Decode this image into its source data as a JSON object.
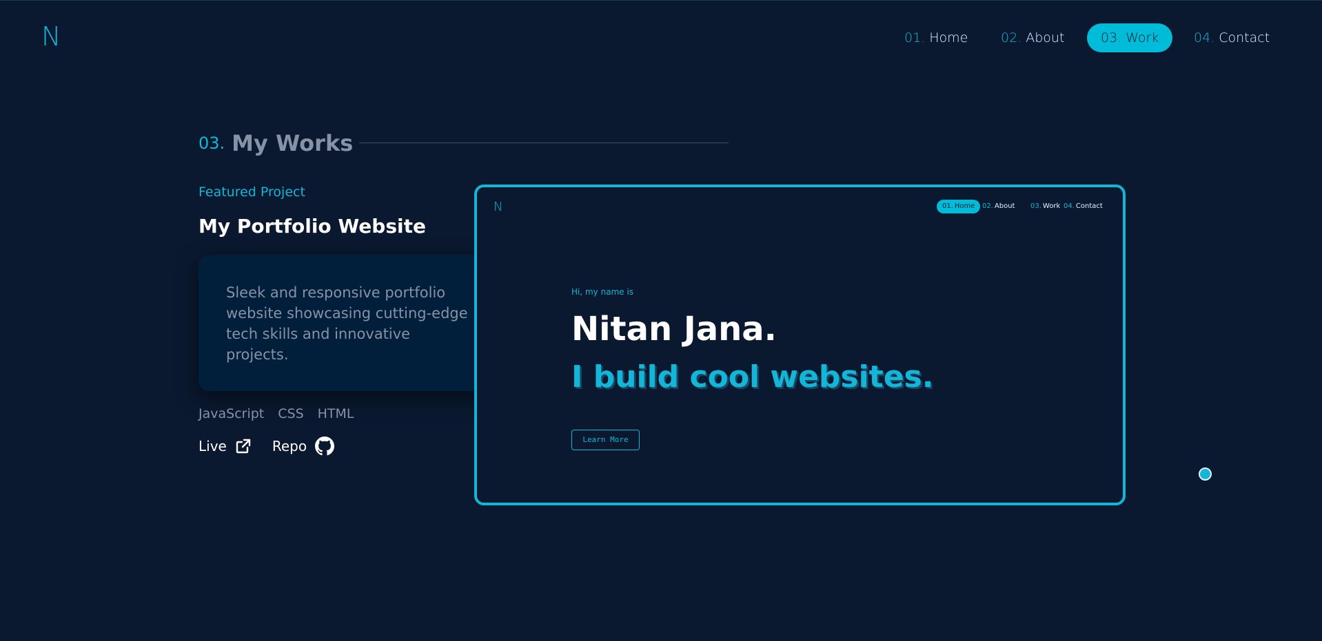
{
  "header": {
    "logo": "N",
    "nav": [
      {
        "num": "01.",
        "label": "Home",
        "active": false
      },
      {
        "num": "02.",
        "label": "About",
        "active": false
      },
      {
        "num": "03.",
        "label": "Work",
        "active": true
      },
      {
        "num": "04.",
        "label": "Contact",
        "active": false
      }
    ]
  },
  "section": {
    "num": "03.",
    "title": "My Works"
  },
  "project": {
    "eyebrow": "Featured Project",
    "title": "My Portfolio Website",
    "description": "Sleek and responsive portfolio website showcasing cutting-edge tech skills and innovative projects.",
    "tech": [
      "JavaScript",
      "CSS",
      "HTML"
    ],
    "links": {
      "live": "Live",
      "repo": "Repo"
    }
  },
  "preview": {
    "logo": "N",
    "nav": [
      {
        "num": "01.",
        "label": "Home",
        "active": true
      },
      {
        "num": "02.",
        "label": "About",
        "active": false
      },
      {
        "num": "03.",
        "label": "Work",
        "active": false
      },
      {
        "num": "04.",
        "label": "Contact",
        "active": false
      }
    ],
    "greeting": "Hi, my name is",
    "name": "Nitan Jana.",
    "tagline": "I build cool websites.",
    "button": "Learn More"
  },
  "colors": {
    "background": "#0a192f",
    "accent": "#13b6d6",
    "text_muted": "#8892a6",
    "card": "#011f3a"
  }
}
